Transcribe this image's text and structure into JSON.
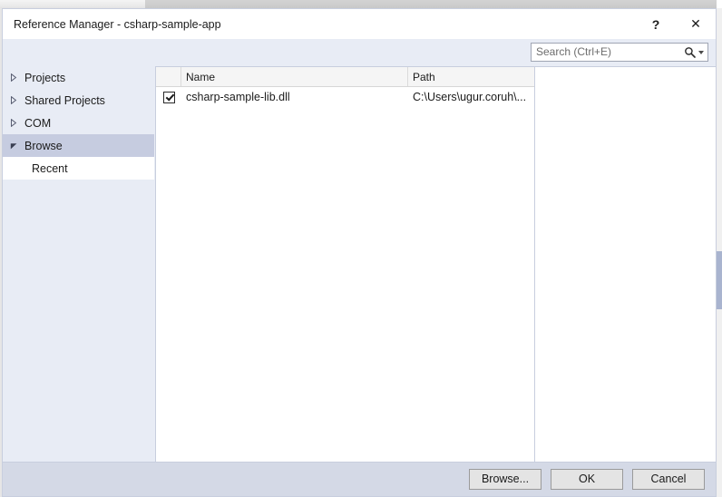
{
  "background": {
    "name": "host-window"
  },
  "dialog": {
    "title": "Reference Manager - csharp-sample-app",
    "titlebar": {
      "help_label": "?",
      "close_label": "✕"
    }
  },
  "search": {
    "placeholder": "Search (Ctrl+E)",
    "value": "",
    "icon": "search-icon",
    "dropdown_icon": "chevron-down-icon"
  },
  "sidebar": {
    "items": [
      {
        "label": "Projects",
        "expanded": false,
        "selected": false,
        "child": false
      },
      {
        "label": "Shared Projects",
        "expanded": false,
        "selected": false,
        "child": false
      },
      {
        "label": "COM",
        "expanded": false,
        "selected": false,
        "child": false
      },
      {
        "label": "Browse",
        "expanded": true,
        "selected": true,
        "child": false
      },
      {
        "label": "Recent",
        "expanded": null,
        "selected": false,
        "child": true
      }
    ]
  },
  "list": {
    "columns": [
      {
        "key": "check",
        "label": ""
      },
      {
        "key": "name",
        "label": "Name"
      },
      {
        "key": "path",
        "label": "Path"
      }
    ],
    "rows": [
      {
        "checked": true,
        "name": "csharp-sample-lib.dll",
        "path": "C:\\Users\\ugur.coruh\\..."
      }
    ]
  },
  "footer": {
    "buttons": [
      {
        "label": "Browse...",
        "name": "browse-button"
      },
      {
        "label": "OK",
        "name": "ok-button"
      },
      {
        "label": "Cancel",
        "name": "cancel-button"
      }
    ]
  },
  "colors": {
    "dialog_bg": "#e8ecf5",
    "selected_item": "#c6cce0",
    "footer_bg": "#d4d9e6",
    "border": "#c8cede",
    "scrollbar_thumb": "#a9b4cf"
  }
}
